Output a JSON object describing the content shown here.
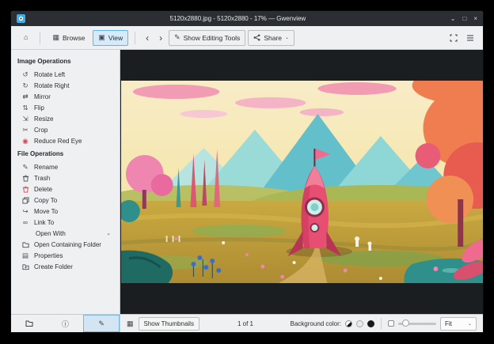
{
  "titlebar": {
    "title": "5120x2880.jpg - 5120x2880 - 17% — Gwenview",
    "minimize_glyph": "⌄",
    "maximize_glyph": "□",
    "close_glyph": "×"
  },
  "toolbar": {
    "home": {
      "icon": "home",
      "glyph": "⌂"
    },
    "browse": {
      "label": "Browse",
      "icon": "browse-grid",
      "glyph": "▦"
    },
    "view": {
      "label": "View",
      "icon": "view-image",
      "glyph": "▣",
      "checked": true
    },
    "back": {
      "icon": "back-arrow",
      "glyph": "‹"
    },
    "forward": {
      "icon": "forward-arrow",
      "glyph": "›"
    },
    "editing_tools": {
      "label": "Show Editing Tools",
      "icon": "pencil",
      "glyph": "✎"
    },
    "share": {
      "label": "Share",
      "icon": "share-nodes",
      "chevron": "⌄"
    },
    "fullscreen": {
      "icon": "fullscreen-corners"
    },
    "menu": {
      "icon": "hamburger-menu"
    }
  },
  "sidebar": {
    "image_operations": {
      "title": "Image Operations",
      "items": [
        {
          "label": "Rotate Left",
          "icon": "rotate-left",
          "glyph": "↺"
        },
        {
          "label": "Rotate Right",
          "icon": "rotate-right",
          "glyph": "↻"
        },
        {
          "label": "Mirror",
          "icon": "mirror",
          "glyph": "⇄"
        },
        {
          "label": "Flip",
          "icon": "flip",
          "glyph": "⇅"
        },
        {
          "label": "Resize",
          "icon": "resize",
          "glyph": "⇲"
        },
        {
          "label": "Crop",
          "icon": "crop",
          "glyph": "✂"
        },
        {
          "label": "Reduce Red Eye",
          "icon": "red-eye",
          "glyph": "◉"
        }
      ]
    },
    "file_operations": {
      "title": "File Operations",
      "items": [
        {
          "label": "Rename",
          "icon": "rename-pencil",
          "glyph": "✎"
        },
        {
          "label": "Trash",
          "icon": "trash-can"
        },
        {
          "label": "Delete",
          "icon": "delete-trash-red"
        },
        {
          "label": "Copy To",
          "icon": "copy-pages"
        },
        {
          "label": "Move To",
          "icon": "move-arrow",
          "glyph": "↪"
        },
        {
          "label": "Link To",
          "icon": "link-chain",
          "glyph": "∞"
        },
        {
          "label": "Open With",
          "icon": "none",
          "chevron": "⌄"
        },
        {
          "label": "Open Containing Folder",
          "icon": "folder"
        },
        {
          "label": "Properties",
          "icon": "document-properties",
          "glyph": "▤"
        },
        {
          "label": "Create Folder",
          "icon": "folder-new"
        }
      ]
    },
    "tabs": [
      {
        "icon": "folder-tab"
      },
      {
        "icon": "info-tab",
        "glyph": "ⓘ"
      },
      {
        "icon": "edit-tab",
        "glyph": "✎",
        "active": true
      }
    ]
  },
  "statusbar": {
    "thumbnails_icon_glyph": "▦",
    "show_thumbnails": "Show Thumbnails",
    "count": "1 of 1",
    "background_color_label": "Background color:",
    "background_swatches": [
      {
        "name": "auto"
      },
      {
        "name": "light"
      },
      {
        "name": "dark"
      }
    ],
    "zoom_mode": "Fit",
    "combo_chevron": "⌄"
  },
  "colors": {
    "accent": "#3daee9",
    "titlebar_bg": "#2b2f33",
    "chrome_bg": "#eff0f1",
    "viewer_bg": "#1b1e20"
  }
}
